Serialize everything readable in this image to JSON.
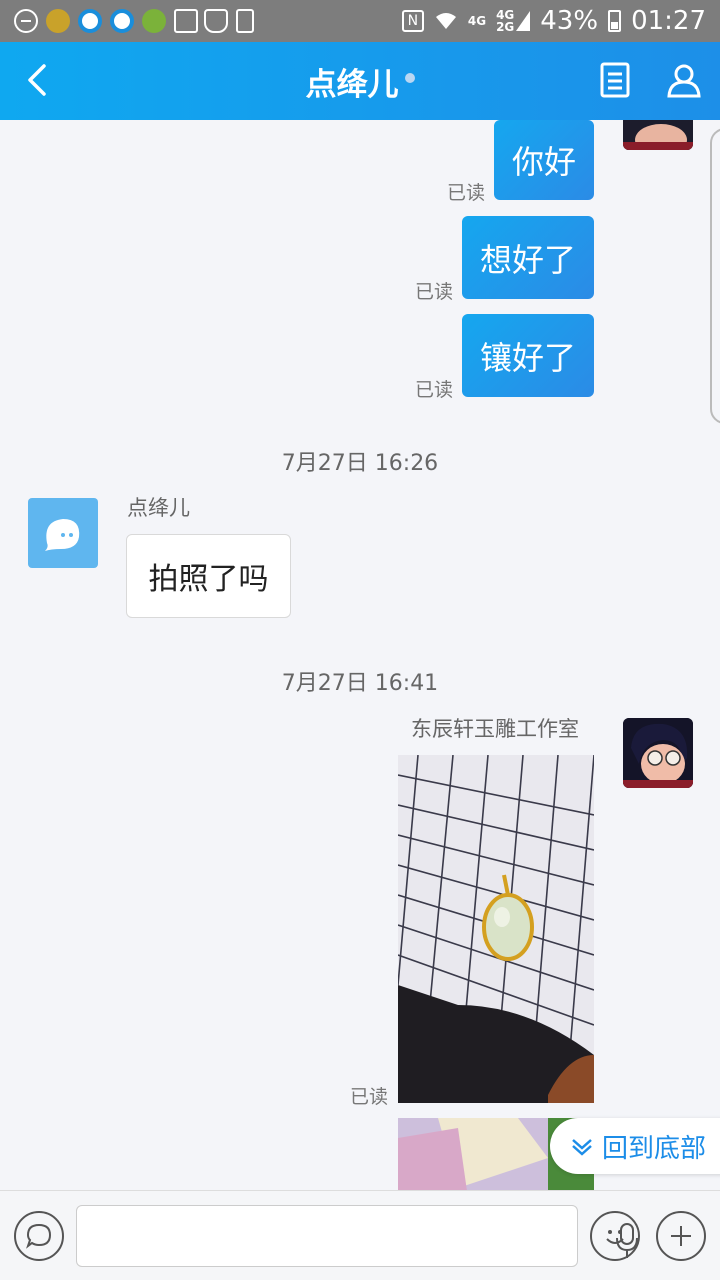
{
  "status_bar": {
    "network_top": "4G",
    "network_bottom": "2G",
    "battery": "43%",
    "time": "01:27"
  },
  "header": {
    "title": "点绛儿"
  },
  "messages": {
    "m1_text": "你好",
    "m1_read": "已读",
    "m2_text": "想好了",
    "m2_read": "已读",
    "m3_text": "镶好了",
    "m3_read": "已读",
    "time1": "7月27日 16:26",
    "other_name": "点绛儿",
    "other_text": "拍照了吗",
    "time2": "7月27日 16:41",
    "me_name": "东辰轩玉雕工作室",
    "photo_read": "已读"
  },
  "back_to_bottom": {
    "label": "回到底部"
  },
  "colors": {
    "accent": "#1d8fe8",
    "bubble_start": "#15a7ef",
    "bubble_end": "#2b8be6"
  },
  "icons": [
    "back-arrow-icon",
    "document-icon",
    "profile-icon",
    "chat-icon",
    "mic-icon",
    "emoji-icon",
    "plus-icon",
    "chevron-down-icon"
  ]
}
